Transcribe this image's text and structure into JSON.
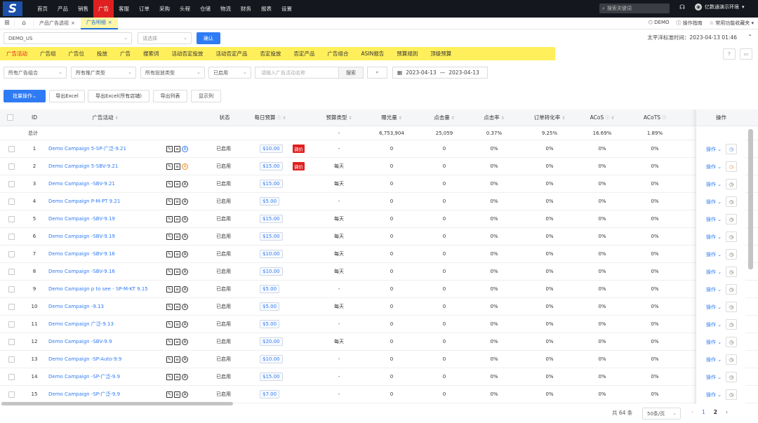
{
  "nav": {
    "logo": "S",
    "items": [
      "首页",
      "产品",
      "销售",
      "广告",
      "客服",
      "订单",
      "采购",
      "头程",
      "仓储",
      "物流",
      "财务",
      "报表",
      "设置"
    ],
    "active_index": 3,
    "search_placeholder": "搜索关键词",
    "user": "亿数通演示环境"
  },
  "pagetabs": [
    {
      "label": "产品广告透视"
    },
    {
      "label": "广告明细"
    }
  ],
  "tabright": {
    "shop": "DEMO",
    "guide": "操作指南",
    "fav": "常用功能收藏夹"
  },
  "filter1": {
    "site": "DEMO_US",
    "select_placeholder": "请选择",
    "confirm": "确认"
  },
  "timeinfo": "太平洋标准时间：2023-04-13 01:46",
  "subtabs": [
    "广告活动",
    "广告组",
    "广告位",
    "投放",
    "广告",
    "搜索词",
    "活动否定投放",
    "活动否定产品",
    "否定投放",
    "否定产品",
    "广告组合",
    "ASIN报告",
    "预算规则",
    "顶级预算"
  ],
  "filter2": {
    "portfolio": "所有广告组合",
    "promo_type": "所有推广类型",
    "target_type": "所有投放类型",
    "status": "已启用",
    "search_placeholder": "请输入广告活动名称",
    "search_btn": "搜索",
    "adv_btn": "⌕",
    "date_from": "2023-04-13",
    "date_sep": "—",
    "date_to": "2023-04-13"
  },
  "actions": {
    "batch": "批量操作",
    "export_excel": "导出Excel",
    "export_all": "导出Excel(所有店铺)",
    "export_list": "导出列表",
    "show_cols": "显示列"
  },
  "columns": {
    "id": "ID",
    "campaign": "广告活动",
    "status": "状态",
    "budget": "每日预算",
    "budget_type": "预算类型",
    "impressions": "曝光量",
    "clicks": "点击量",
    "ctr": "点击率",
    "cvr": "订单转化率",
    "acos": "ACoS",
    "acots": "ACoTS",
    "ops": "操作"
  },
  "totals": {
    "label": "总计",
    "budget_type": "-",
    "impressions": "6,753,904",
    "clicks": "25,059",
    "ctr": "0.37%",
    "cvr": "9.25%",
    "acos": "16.69%",
    "acots": "1.89%"
  },
  "rows": [
    {
      "id": "1",
      "name": "Demo Campaign 5-SP-广泛-9.21",
      "status": "已启用",
      "budget": "$10.00",
      "tag": "调价",
      "btype": "-",
      "imp": "0",
      "clk": "0",
      "ctr": "0%",
      "cvr": "0%",
      "acos": "0%",
      "acots": "0%",
      "op": "操作",
      "a_icon": "blue",
      "clock": "blue"
    },
    {
      "id": "2",
      "name": "Demo Campaign 5-SBV-9.21",
      "status": "已启用",
      "budget": "$15.00",
      "tag": "调价",
      "btype": "每天",
      "imp": "0",
      "clk": "0",
      "ctr": "0%",
      "cvr": "0%",
      "acos": "0%",
      "acots": "0%",
      "op": "操作",
      "a_icon": "orange",
      "clock": "orange"
    },
    {
      "id": "3",
      "name": "Demo Campaign -SBV-9.21",
      "status": "已启用",
      "budget": "$15.00",
      "tag": "",
      "btype": "每天",
      "imp": "0",
      "clk": "0",
      "ctr": "0%",
      "cvr": "0%",
      "acos": "0%",
      "acots": "0%",
      "op": "操作",
      "a_icon": "dark",
      "clock": "dark"
    },
    {
      "id": "4",
      "name": "Demo Campaign P-M-PT 9.21",
      "status": "已启用",
      "budget": "$5.00",
      "tag": "",
      "btype": "-",
      "imp": "0",
      "clk": "0",
      "ctr": "0%",
      "cvr": "0%",
      "acos": "0%",
      "acots": "0%",
      "op": "操作",
      "a_icon": "dark",
      "clock": "dark"
    },
    {
      "id": "5",
      "name": "Demo Campaign -SBV-9.19",
      "status": "已启用",
      "budget": "$15.00",
      "tag": "",
      "btype": "每天",
      "imp": "0",
      "clk": "0",
      "ctr": "0%",
      "cvr": "0%",
      "acos": "0%",
      "acots": "0%",
      "op": "操作",
      "a_icon": "dark",
      "clock": "dark"
    },
    {
      "id": "6",
      "name": "Demo Campaign -SBV-9.19",
      "status": "已启用",
      "budget": "$15.00",
      "tag": "",
      "btype": "每天",
      "imp": "0",
      "clk": "0",
      "ctr": "0%",
      "cvr": "0%",
      "acos": "0%",
      "acots": "0%",
      "op": "操作",
      "a_icon": "dark",
      "clock": "dark"
    },
    {
      "id": "7",
      "name": "Demo Campaign -SBV-9.16",
      "status": "已启用",
      "budget": "$10.00",
      "tag": "",
      "btype": "每天",
      "imp": "0",
      "clk": "0",
      "ctr": "0%",
      "cvr": "0%",
      "acos": "0%",
      "acots": "0%",
      "op": "操作",
      "a_icon": "dark",
      "clock": "dark"
    },
    {
      "id": "8",
      "name": "Demo Campaign -SBV-9.16",
      "status": "已启用",
      "budget": "$10.00",
      "tag": "",
      "btype": "每天",
      "imp": "0",
      "clk": "0",
      "ctr": "0%",
      "cvr": "0%",
      "acos": "0%",
      "acots": "0%",
      "op": "操作",
      "a_icon": "dark",
      "clock": "dark"
    },
    {
      "id": "9",
      "name": "Demo Campaign p to see - SP-M-KT 9.15",
      "status": "已启用",
      "budget": "$5.00",
      "tag": "",
      "btype": "-",
      "imp": "0",
      "clk": "0",
      "ctr": "0%",
      "cvr": "0%",
      "acos": "0%",
      "acots": "0%",
      "op": "操作",
      "a_icon": "dark",
      "clock": "dark"
    },
    {
      "id": "10",
      "name": "Demo Campaign -9.13",
      "status": "已启用",
      "budget": "$5.00",
      "tag": "",
      "btype": "每天",
      "imp": "0",
      "clk": "0",
      "ctr": "0%",
      "cvr": "0%",
      "acos": "0%",
      "acots": "0%",
      "op": "操作",
      "a_icon": "dark",
      "clock": "dark"
    },
    {
      "id": "11",
      "name": "Demo Campaign 广泛-9.13",
      "status": "已启用",
      "budget": "$5.00",
      "tag": "",
      "btype": "-",
      "imp": "0",
      "clk": "0",
      "ctr": "0%",
      "cvr": "0%",
      "acos": "0%",
      "acots": "0%",
      "op": "操作",
      "a_icon": "dark",
      "clock": "dark"
    },
    {
      "id": "12",
      "name": "Demo Campaign -SBV-9.9",
      "status": "已启用",
      "budget": "$20.00",
      "tag": "",
      "btype": "每天",
      "imp": "0",
      "clk": "0",
      "ctr": "0%",
      "cvr": "0%",
      "acos": "0%",
      "acots": "0%",
      "op": "操作",
      "a_icon": "dark",
      "clock": "dark"
    },
    {
      "id": "13",
      "name": "Demo Campaign -SP-Auto-9.9",
      "status": "已启用",
      "budget": "$10.00",
      "tag": "",
      "btype": "-",
      "imp": "0",
      "clk": "0",
      "ctr": "0%",
      "cvr": "0%",
      "acos": "0%",
      "acots": "0%",
      "op": "操作",
      "a_icon": "dark",
      "clock": "dark"
    },
    {
      "id": "14",
      "name": "Demo Campaign -SP-广泛-9.9",
      "status": "已启用",
      "budget": "$15.00",
      "tag": "",
      "btype": "-",
      "imp": "0",
      "clk": "0",
      "ctr": "0%",
      "cvr": "0%",
      "acos": "0%",
      "acots": "0%",
      "op": "操作",
      "a_icon": "dark",
      "clock": "dark"
    },
    {
      "id": "15",
      "name": "Demo Campaign -SP-广泛-9.9",
      "status": "已启用",
      "budget": "$7.00",
      "tag": "",
      "btype": "-",
      "imp": "0",
      "clk": "0",
      "ctr": "0%",
      "cvr": "0%",
      "acos": "0%",
      "acots": "0%",
      "op": "操作",
      "a_icon": "dark",
      "clock": "dark"
    }
  ],
  "pager": {
    "total": "共 64 条",
    "pagesize": "50条/页",
    "pages": [
      "1",
      "2"
    ],
    "current": "1"
  },
  "colors": {
    "accent": "#2f7bf5",
    "nav_active": "#e02020",
    "highlight": "#ffef5a"
  }
}
